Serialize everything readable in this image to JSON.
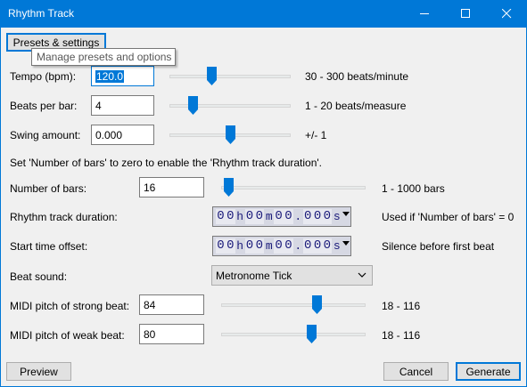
{
  "window": {
    "title": "Rhythm Track",
    "minimize_icon": "minimize-icon",
    "maximize_icon": "maximize-icon",
    "close_icon": "close-icon"
  },
  "presets_button": "Presets & settings",
  "tooltip": "Manage presets and options",
  "controls": {
    "tempo": {
      "label": "Tempo (bpm):",
      "value": "120.0",
      "range": "30 - 300 beats/minute",
      "min": 30,
      "max": 300,
      "current": 120
    },
    "beats_per_bar": {
      "label": "Beats per bar:",
      "value": "4",
      "range": "1 - 20 beats/measure",
      "min": 1,
      "max": 20,
      "current": 4
    },
    "swing": {
      "label": "Swing amount:",
      "value": "0.000",
      "range": "+/- 1",
      "min": -1,
      "max": 1,
      "current": 0
    }
  },
  "hint": "Set 'Number of bars' to zero to enable the 'Rhythm track duration'.",
  "number_of_bars": {
    "label": "Number of bars:",
    "value": "16",
    "range": "1 - 1000 bars",
    "min": 1,
    "max": 1000,
    "current": 16
  },
  "duration": {
    "label": "Rhythm track duration:",
    "digits": [
      "0",
      "0",
      "0",
      "0",
      "0",
      "0",
      "0"
    ],
    "units": {
      "h": "h",
      "m": "m",
      "s": "s",
      "dot": "."
    },
    "note": "Used if 'Number of bars' = 0"
  },
  "start_offset": {
    "label": "Start time offset:",
    "note": "Silence before first beat"
  },
  "beat_sound": {
    "label": "Beat sound:",
    "value": "Metronome Tick"
  },
  "strong_pitch": {
    "label": "MIDI pitch of strong beat:",
    "value": "84",
    "range": "18 - 116",
    "min": 18,
    "max": 116,
    "current": 84
  },
  "weak_pitch": {
    "label": "MIDI pitch of weak beat:",
    "value": "80",
    "range": "18 - 116",
    "min": 18,
    "max": 116,
    "current": 80
  },
  "buttons": {
    "preview": "Preview",
    "cancel": "Cancel",
    "generate": "Generate"
  },
  "colors": {
    "accent": "#0078d7",
    "thumb": "#0078d7",
    "dialog_bg": "#f0f0f0"
  }
}
